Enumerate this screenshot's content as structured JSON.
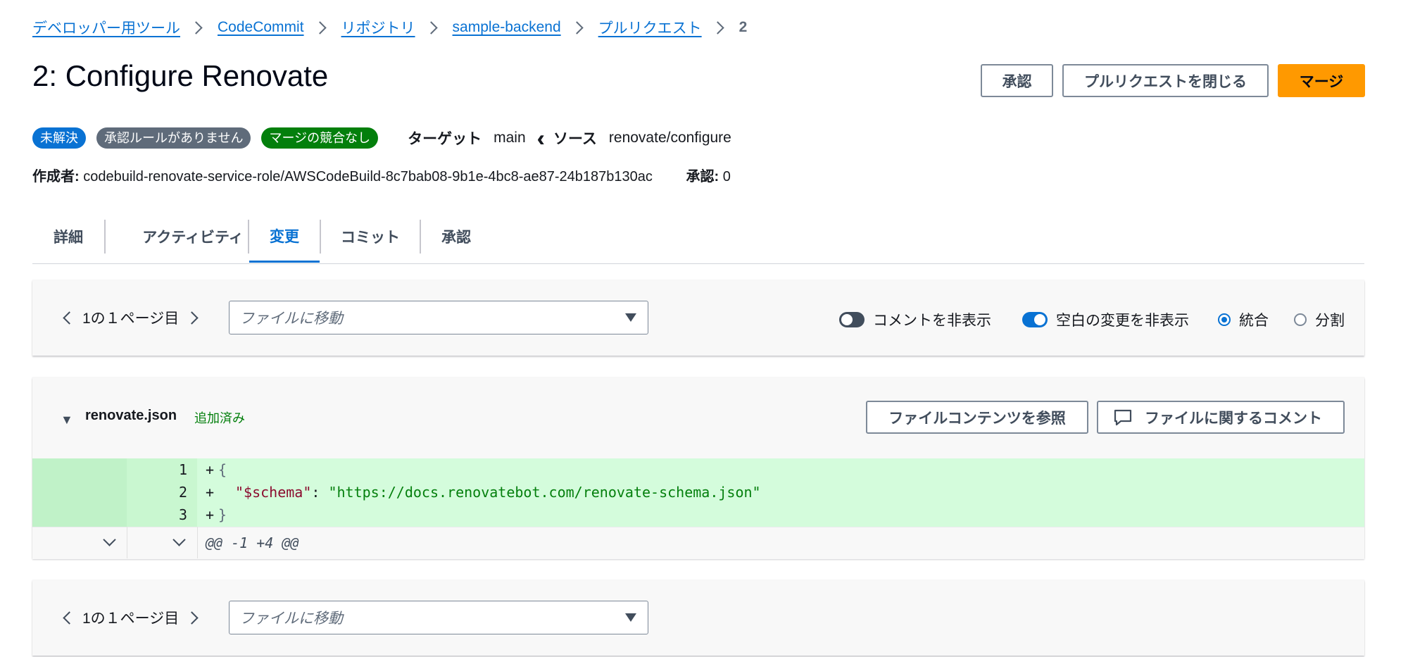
{
  "breadcrumb": {
    "items": [
      "デベロッパー用ツール",
      "CodeCommit",
      "リポジトリ",
      "sample-backend",
      "プルリクエスト"
    ],
    "current": "2"
  },
  "title": "2: Configure Renovate",
  "actions": {
    "approve": "承認",
    "close_pr": "プルリクエストを閉じる",
    "merge": "マージ"
  },
  "badges": [
    {
      "label": "未解決",
      "color": "#0972d3"
    },
    {
      "label": "承認ルールがありません",
      "color": "#5f6b7a"
    },
    {
      "label": "マージの競合なし",
      "color": "#037f0c"
    }
  ],
  "branches": {
    "target_label": "ターゲット",
    "target": "main",
    "source_label": "ソース",
    "source": "renovate/configure"
  },
  "author": {
    "label": "作成者:",
    "value": "codebuild-renovate-service-role/AWSCodeBuild-8c7bab08-9b1e-4bc8-ae87-24b187b130ac"
  },
  "approvals": {
    "label": "承認:",
    "value": "0"
  },
  "tabs": [
    "詳細",
    "アクティビティ",
    "変更",
    "コミット",
    "承認"
  ],
  "active_tab": "変更",
  "toolbar": {
    "pager": "1の１ページ目",
    "file_select_placeholder": "ファイルに移動",
    "hide_comments": "コメントを非表示",
    "hide_comments_on": false,
    "hide_whitespace": "空白の変更を非表示",
    "hide_whitespace_on": true,
    "unified": "統合",
    "split": "分割",
    "view_mode": "統合"
  },
  "file": {
    "name": "renovate.json",
    "status": "追加済み",
    "browse_button": "ファイルコンテンツを参照",
    "comment_button": "ファイルに関するコメント",
    "lines": [
      {
        "num": "1",
        "prefix": "+",
        "content": "{"
      },
      {
        "num": "2",
        "prefix": "+",
        "key": "\"$schema\"",
        "sep": ": ",
        "value": "\"https://docs.renovatebot.com/renovate-schema.json\""
      },
      {
        "num": "3",
        "prefix": "+",
        "content": "}"
      }
    ],
    "hunk": "@@ -1 +4 @@"
  },
  "bottom_toolbar": {
    "pager": "1の１ページ目",
    "file_select_placeholder": "ファイルに移動"
  }
}
